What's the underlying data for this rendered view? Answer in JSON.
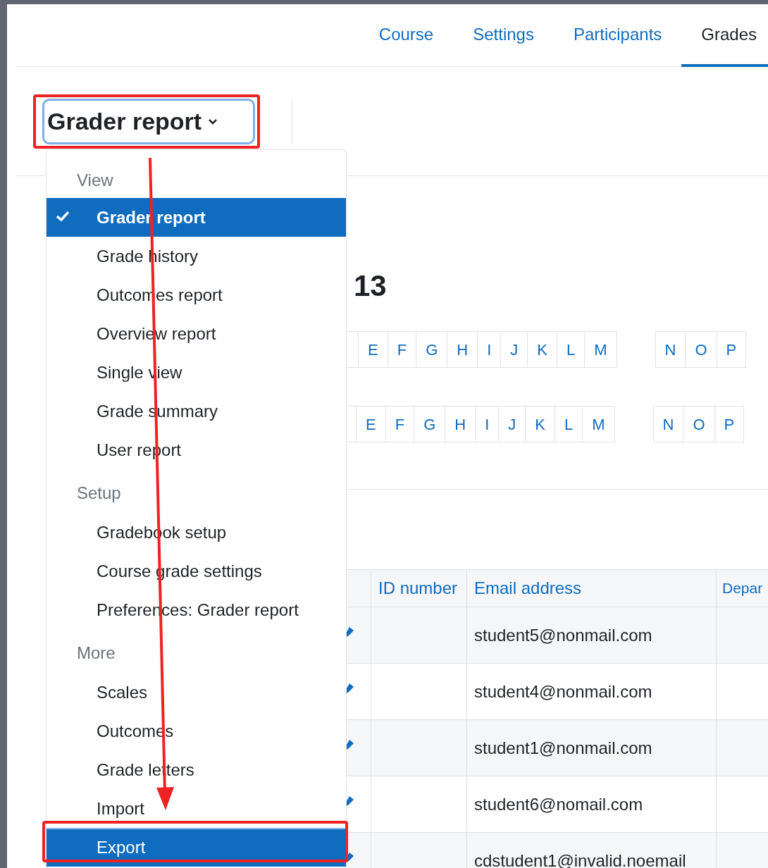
{
  "tabs": [
    {
      "label": "Course",
      "selected": false
    },
    {
      "label": "Settings",
      "selected": false
    },
    {
      "label": "Participants",
      "selected": false
    },
    {
      "label": "Grades",
      "selected": true
    }
  ],
  "report_selector": {
    "label": "Grader report"
  },
  "menu": {
    "sections": [
      {
        "heading": "View",
        "items": [
          {
            "label": "Grader report",
            "selected": true,
            "highlighted": false
          },
          {
            "label": "Grade history",
            "selected": false,
            "highlighted": false
          },
          {
            "label": "Outcomes report",
            "selected": false,
            "highlighted": false
          },
          {
            "label": "Overview report",
            "selected": false,
            "highlighted": false
          },
          {
            "label": "Single view",
            "selected": false,
            "highlighted": false
          },
          {
            "label": "Grade summary",
            "selected": false,
            "highlighted": false
          },
          {
            "label": "User report",
            "selected": false,
            "highlighted": false
          }
        ]
      },
      {
        "heading": "Setup",
        "items": [
          {
            "label": "Gradebook setup",
            "selected": false,
            "highlighted": false
          },
          {
            "label": "Course grade settings",
            "selected": false,
            "highlighted": false
          },
          {
            "label": "Preferences: Grader report",
            "selected": false,
            "highlighted": false
          }
        ]
      },
      {
        "heading": "More",
        "items": [
          {
            "label": "Scales",
            "selected": false,
            "highlighted": false
          },
          {
            "label": "Outcomes",
            "selected": false,
            "highlighted": false
          },
          {
            "label": "Grade letters",
            "selected": false,
            "highlighted": false
          },
          {
            "label": "Import",
            "selected": false,
            "highlighted": false
          },
          {
            "label": "Export",
            "selected": false,
            "highlighted": true
          }
        ]
      }
    ]
  },
  "page_heading": "13",
  "letter_rows": [
    {
      "groups": [
        [
          "E",
          "F",
          "G",
          "H",
          "I",
          "J",
          "K",
          "L",
          "M"
        ],
        [
          "N",
          "O",
          "P"
        ]
      ]
    },
    {
      "groups": [
        [
          "E",
          "F",
          "G",
          "H",
          "I",
          "J",
          "K",
          "L",
          "M"
        ],
        [
          "N",
          "O",
          "P"
        ]
      ]
    }
  ],
  "table": {
    "columns": [
      "ID number",
      "Email address",
      "Depar"
    ],
    "rows": [
      {
        "email": "student5@nonmail.com"
      },
      {
        "email": "student4@nonmail.com"
      },
      {
        "email": "student1@nonmail.com"
      },
      {
        "email": "student6@nomail.com"
      },
      {
        "email": "cdstudent1@invalid.noemail"
      }
    ]
  }
}
